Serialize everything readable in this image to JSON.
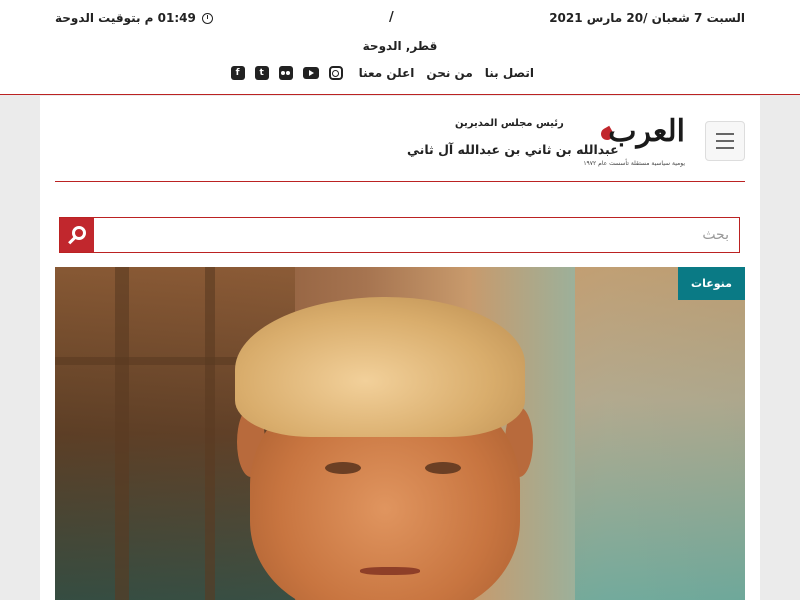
{
  "topbar": {
    "date": "السبت 7 شعبان /20 مارس 2021",
    "separator": "/",
    "time": "01:49 م بتوقيت الدوحة",
    "location": "قطر, الدوحة",
    "nav": [
      "اتصل بنا",
      "من نحن",
      "اعلن معنا"
    ],
    "social": [
      "instagram-icon",
      "youtube-icon",
      "flickr-icon",
      "twitter-icon",
      "facebook-icon"
    ]
  },
  "masthead": {
    "logo_text": "العرب",
    "logo_sub": "يومية سياسية مستقلة تأسست عام ١٩٧٢",
    "chair_label": "رئيس مجلس المديرين",
    "chair_name": "عبدالله بن ثاني بن عبدالله آل ثاني"
  },
  "search": {
    "placeholder": "بحث"
  },
  "hero": {
    "category": "منوعات"
  },
  "colors": {
    "accent": "#c1272d",
    "tag": "#0a7a85"
  }
}
